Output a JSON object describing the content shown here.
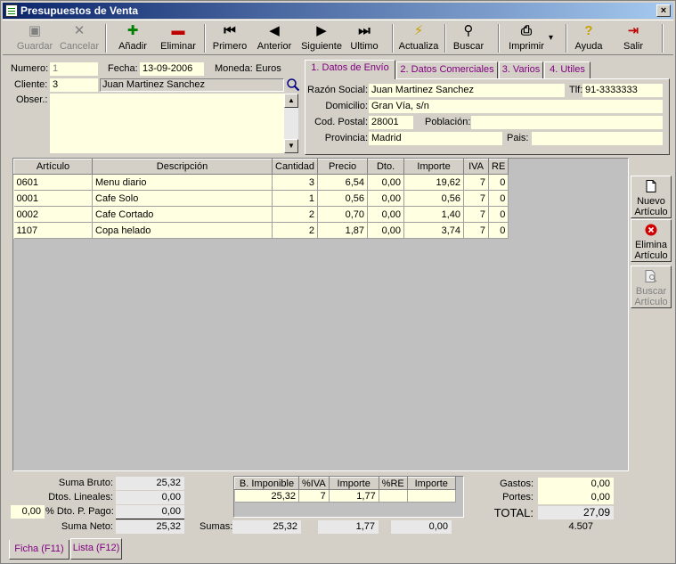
{
  "window": {
    "title": "Presupuestos de Venta",
    "close_glyph": "×"
  },
  "toolbar": {
    "buttons": [
      {
        "id": "guardar",
        "label": "Guardar",
        "icon": "floppy-icon",
        "glyph": "▣",
        "color": "#808080",
        "enabled": false
      },
      {
        "id": "cancelar",
        "label": "Cancelar",
        "icon": "x-icon",
        "glyph": "✕",
        "color": "#808080",
        "enabled": false
      },
      {
        "id": "anadir",
        "label": "Añadir",
        "icon": "plus-icon",
        "glyph": "✚",
        "color": "#008000",
        "enabled": true
      },
      {
        "id": "eliminar",
        "label": "Eliminar",
        "icon": "minus-icon",
        "glyph": "▬",
        "color": "#c00000",
        "enabled": true
      },
      {
        "id": "primero",
        "label": "Primero",
        "icon": "first-icon",
        "glyph": "⏮",
        "color": "#000000",
        "enabled": true
      },
      {
        "id": "anterior",
        "label": "Anterior",
        "icon": "prev-icon",
        "glyph": "◀",
        "color": "#000000",
        "enabled": true
      },
      {
        "id": "siguiente",
        "label": "Siguiente",
        "icon": "next-icon",
        "glyph": "▶",
        "color": "#000000",
        "enabled": true
      },
      {
        "id": "ultimo",
        "label": "Ultimo",
        "icon": "last-icon",
        "glyph": "⏭",
        "color": "#000000",
        "enabled": true
      },
      {
        "id": "actualiza",
        "label": "Actualiza",
        "icon": "lightning-icon",
        "glyph": "⚡",
        "color": "#c8a000",
        "enabled": true
      },
      {
        "id": "buscar",
        "label": "Buscar",
        "icon": "binoculars-icon",
        "glyph": "⚲",
        "color": "#000000",
        "enabled": true
      },
      {
        "id": "imprimir",
        "label": "Imprimir",
        "icon": "printer-icon",
        "glyph": "⎙",
        "color": "#000000",
        "enabled": true
      },
      {
        "id": "ayuda",
        "label": "Ayuda",
        "icon": "help-icon",
        "glyph": "?",
        "color": "#c8a000",
        "enabled": true
      },
      {
        "id": "salir",
        "label": "Salir",
        "icon": "exit-door-icon",
        "glyph": "⇥",
        "color": "#c00000",
        "enabled": true
      }
    ],
    "dropdown_glyph": "▾"
  },
  "header": {
    "numero_label": "Numero:",
    "numero": "1",
    "fecha_label": "Fecha:",
    "fecha": "13-09-2006",
    "moneda_label": "Moneda:",
    "moneda": "Euros",
    "cliente_label": "Cliente:",
    "cliente_code": "3",
    "cliente_name": "Juan Martinez Sanchez",
    "obser_label": "Obser.:",
    "obser": ""
  },
  "tabs": [
    {
      "label": "1. Datos de Envío",
      "active": true
    },
    {
      "label": "2. Datos Comerciales",
      "active": false
    },
    {
      "label": "3. Varios",
      "active": false
    },
    {
      "label": "4. Utiles",
      "active": false
    }
  ],
  "envio": {
    "razon_label": "Razón Social:",
    "razon": "Juan Martinez Sanchez",
    "tlf_label": "Tlf:",
    "tlf": "91-3333333",
    "domicilio_label": "Domicilio:",
    "domicilio": "Gran Vía, s/n",
    "cp_label": "Cod. Postal:",
    "cp": "28001",
    "poblacion_label": "Población:",
    "poblacion": "",
    "provincia_label": "Provincia:",
    "provincia": "Madrid",
    "pais_label": "Pais:",
    "pais": ""
  },
  "grid": {
    "columns": [
      "Artículo",
      "Descripción",
      "Cantidad",
      "Precio",
      "Dto.",
      "Importe",
      "IVA",
      "RE"
    ],
    "rows": [
      [
        "0601",
        "Menu diario",
        "3",
        "6,54",
        "0,00",
        "19,62",
        "7",
        "0"
      ],
      [
        "0001",
        "Cafe Solo",
        "1",
        "0,56",
        "0,00",
        "0,56",
        "7",
        "0"
      ],
      [
        "0002",
        "Cafe Cortado",
        "2",
        "0,70",
        "0,00",
        "1,40",
        "7",
        "0"
      ],
      [
        "1107",
        "Copa helado",
        "2",
        "1,87",
        "0,00",
        "3,74",
        "7",
        "0"
      ]
    ]
  },
  "side_buttons": [
    {
      "label1": "Nuevo",
      "label2": "Artículo",
      "icon": "new-document-icon",
      "enabled": true
    },
    {
      "label1": "Elimina",
      "label2": "Artículo",
      "icon": "delete-red-icon",
      "enabled": true
    },
    {
      "label1": "Buscar",
      "label2": "Artículo",
      "icon": "search-document-icon",
      "enabled": false
    }
  ],
  "totals": {
    "suma_bruto_label": "Suma Bruto:",
    "suma_bruto": "25,32",
    "dtos_lineales_label": "Dtos. Lineales:",
    "dtos_lineales": "0,00",
    "dto_pago_pct": "0,00",
    "dto_pago_label": "% Dto. P. Pago:",
    "dto_pago": "0,00",
    "suma_neto_label": "Suma Neto:",
    "suma_neto": "25,32",
    "tax_columns": [
      "B. Imponible",
      "%IVA",
      "Importe",
      "%RE",
      "Importe"
    ],
    "tax_rows": [
      [
        "25,32",
        "7",
        "1,77",
        "",
        ""
      ]
    ],
    "sumas_label": "Sumas:",
    "sumas_base": "25,32",
    "sumas_iva": "1,77",
    "sumas_re": "0,00",
    "gastos_label": "Gastos:",
    "gastos": "0,00",
    "portes_label": "Portes:",
    "portes": "0,00",
    "total_label": "TOTAL:",
    "total": "27,09",
    "total_alt": "4.507"
  },
  "bottom_tabs": [
    "Ficha (F11)",
    "Lista (F12)"
  ]
}
